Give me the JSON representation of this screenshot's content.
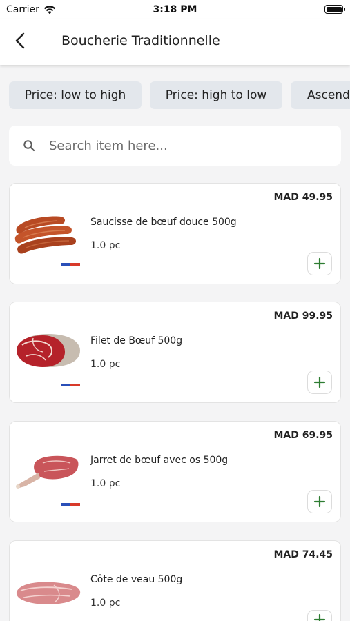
{
  "status_bar": {
    "carrier": "Carrier",
    "time": "3:18 PM"
  },
  "header": {
    "title": "Boucherie Traditionnelle",
    "back_icon": "chevron-left-icon"
  },
  "sort_chips": [
    {
      "label": "Price: low to high"
    },
    {
      "label": "Price: high to low"
    },
    {
      "label": "Ascending"
    }
  ],
  "search": {
    "placeholder": "Search item here...",
    "value": ""
  },
  "products": [
    {
      "name": "Saucisse de bœuf douce 500g",
      "price": "MAD 49.95",
      "quantity": "1.0 pc",
      "image": "sausages"
    },
    {
      "name": "Filet de Bœuf 500g",
      "price": "MAD 99.95",
      "quantity": "1.0 pc",
      "image": "beef-fillet"
    },
    {
      "name": "Jarret de bœuf avec os 500g",
      "price": "MAD 69.95",
      "quantity": "1.0 pc",
      "image": "beef-shank"
    },
    {
      "name": "Côte de veau 500g",
      "price": "MAD 74.45",
      "quantity": "1.0 pc",
      "image": "veal-chop"
    }
  ],
  "colors": {
    "accent": "#2e7d32",
    "chip_bg": "#e3e7ec",
    "page_bg": "#f4f4f5"
  }
}
